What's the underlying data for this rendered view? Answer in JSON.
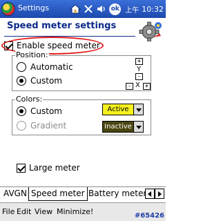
{
  "titlebar": {
    "title": "Settings",
    "ok_label": "ok",
    "ampm": "上午",
    "time": "10:32"
  },
  "page": {
    "title": "Speed meter settings"
  },
  "enable": {
    "label": "Enable speed meter",
    "checked": true
  },
  "position_group": {
    "legend": "Position:",
    "options": [
      {
        "label": "Automatic",
        "selected": false
      },
      {
        "label": "Custom",
        "selected": true
      }
    ],
    "x_label": "X",
    "y_label": "Y",
    "plus": "+",
    "minus": "-"
  },
  "colors_group": {
    "legend": "Colors:",
    "options": [
      {
        "label": "Custom",
        "selected": true,
        "enabled": true
      },
      {
        "label": "Gradient",
        "selected": false,
        "enabled": false
      }
    ],
    "active_label": "Active",
    "active_color": "#f5f01e",
    "inactive_label": "Inactive",
    "inactive_color": "#4b4610"
  },
  "large_meter": {
    "label": "Large meter",
    "checked": true
  },
  "tabs": [
    {
      "label": "AVGN",
      "active": false
    },
    {
      "label": "Speed meter",
      "active": true
    },
    {
      "label": "Battery meter",
      "active": false
    }
  ],
  "menubar": {
    "items": [
      "File",
      "Edit",
      "View",
      "Minimize!"
    ]
  },
  "watermark": "#65426"
}
